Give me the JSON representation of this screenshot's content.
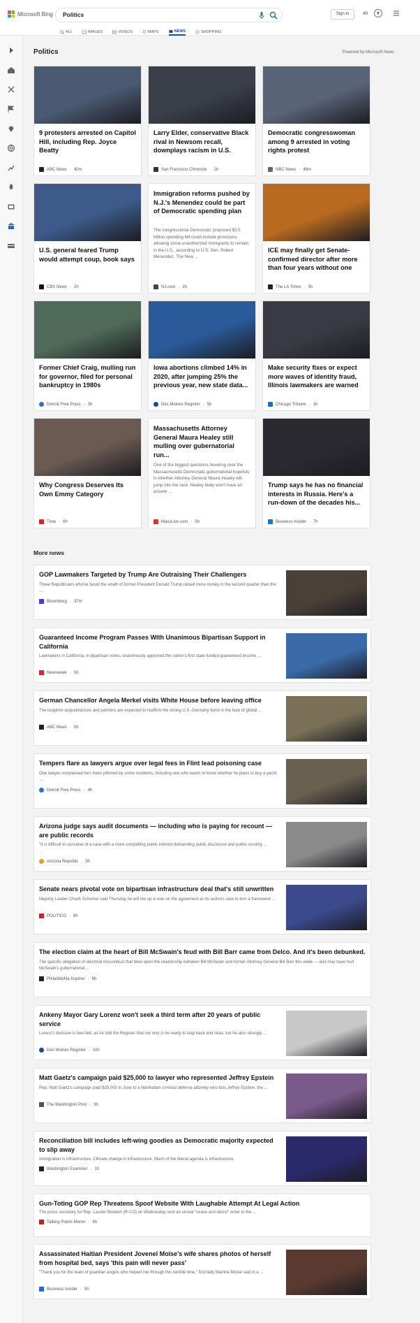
{
  "header": {
    "logo_text": "Microsoft Bing",
    "query": "Politics",
    "sign_in": "Sign in",
    "points": "40",
    "tabs": [
      {
        "label": "ALL",
        "icon": "search-icon"
      },
      {
        "label": "IMAGES",
        "icon": "image-icon"
      },
      {
        "label": "VIDEOS",
        "icon": "video-icon"
      },
      {
        "label": "MAPS",
        "icon": "map-pin-icon"
      },
      {
        "label": "NEWS",
        "icon": "news-icon",
        "active": true
      },
      {
        "label": "SHOPPING",
        "icon": "tag-icon"
      }
    ]
  },
  "rail_icons": [
    "chevron-right-icon",
    "home-icon",
    "topics-icon",
    "flag-icon",
    "location-icon",
    "globe-icon",
    "chart-icon",
    "rocket-icon",
    "film-icon",
    "politics-icon",
    "card-icon"
  ],
  "section": {
    "title": "Politics",
    "powered": "Powered by Microsoft News"
  },
  "cards": [
    {
      "title": "9 protesters arrested on Capitol Hill, including Rep. Joyce Beatty",
      "source": "ABC News",
      "time": "40m",
      "color": "#4a5a72"
    },
    {
      "title": "Larry Elder, conservative Black rival in Newsom recall, downplays racism in U.S.",
      "source": "San Francisco Chronicle",
      "time": "1h",
      "color": "#3a3f4a"
    },
    {
      "title": "Democratic congresswoman among 9 arrested in voting rights protest",
      "source": "NBC News",
      "time": "46m",
      "color": "#5a6478"
    },
    {
      "title": "U.S. general feared Trump would attempt coup, book says",
      "source": "CBS News",
      "time": "2h",
      "color": "#3d5a8a"
    },
    {
      "title": "Immigration reforms pushed by N.J.'s Menendez could be part of Democratic spending plan",
      "snippet": "The congressional Democrats' proposed $3.5 trillion spending bill could include provisions allowing some unauthorized immigrants to remain in the U.S., according to U.S. Sen. Robert Menendez. The New ...",
      "source": "NJ.com",
      "time": "2h"
    },
    {
      "title": "ICE may finally get Senate-confirmed director after more than four years without one",
      "source": "The LA Times",
      "time": "5h",
      "color": "#b86a20"
    },
    {
      "title": "Former Chief Craig, mulling run for governor, filed for personal bankruptcy in 1980s",
      "source": "Detroit Free Press",
      "time": "2h",
      "color": "#4f6a58"
    },
    {
      "title": "Iowa abortions climbed 14% in 2020, after jumping 25% the previous year, new state data...",
      "source": "Des Moines Register",
      "time": "5h",
      "color": "#2b5a9a"
    },
    {
      "title": "Make security fixes or expect more waves of identity fraud, Illinois lawmakers are warned",
      "source": "Chicago Tribune",
      "time": "1h",
      "color": "#3a3a44"
    },
    {
      "title": "Why Congress Deserves Its Own Emmy Category",
      "source": "Time",
      "time": "6h",
      "color": "#6a5a52"
    },
    {
      "title": "Massachusetts Attorney General Maura Healey still mulling over gubernatorial run...",
      "snippet": "One of the biggest questions hovering over the Massachusetts Democratic gubernatorial hopefuls is whether Attorney General Maura Healey will jump into the race. Healey likely won't have an answer ...",
      "source": "MassLive.com",
      "time": "5h"
    },
    {
      "title": "Trump says he has no financial interests in Russia. Here's a run-down of the decades his...",
      "source": "Business Insider",
      "time": "7h",
      "color": "#2a2a30"
    }
  ],
  "more_news_title": "More news",
  "more_news": [
    {
      "title": "GOP Lawmakers Targeted by Trump Are Outraising Their Challengers",
      "snippet": "Three Republicans who've faced the wrath of former President Donald Trump raised more money in the second quarter than the ...",
      "source": "Bloomberg",
      "time": "37m",
      "color": "#4a4038"
    },
    {
      "title": "Guaranteed Income Program Passes With Unanimous Bipartisan Support in California",
      "snippet": "Lawmakers in California, in bipartisan votes, unanimously approved the nation's first state-funded guaranteed income ...",
      "source": "Newsweek",
      "time": "5h",
      "color": "#3a6aa8"
    },
    {
      "title": "German Chancellor Angela Merkel visits White House before leaving office",
      "snippet": "The longtime acquaintances and partners are expected to reaffirm the strong U.S.-Germany bond in the face of global ...",
      "source": "ABC News",
      "time": "5h",
      "color": "#7a7058"
    },
    {
      "title": "Tempers flare as lawyers argue over legal fees in Flint lead poisoning case",
      "snippet": "One lawyer complained he's been pilloried by some residents, including one who wants to know whether he plans to buy a yacht ...",
      "source": "Detroit Free Press",
      "time": "4h",
      "color": "#6a6050"
    },
    {
      "title": "Arizona judge says audit documents — including who is paying for recount — are public records",
      "snippet": "\"It is difficult to conceive of a case with a more compelling public interest demanding public disclosure and public scrutiny ...",
      "source": "Arizona Republic",
      "time": "5h",
      "color": "#8a8a8a"
    },
    {
      "title": "Senate nears pivotal vote on bipartisan infrastructure deal that's still unwritten",
      "snippet": "Majority Leader Chuck Schumer said Thursday he will tee up a vote on the agreement as its authors race to turn a framework ...",
      "source": "POLITICO",
      "time": "8h",
      "color": "#3a4a8a"
    },
    {
      "title": "The election claim at the heart of Bill McSwain's feud with Bill Barr came from Delco. And it's been debunked.",
      "snippet": "The specific allegation of electoral misconduct that blew open the relationship between Bill McSwain and former Attorney General Bill Barr this week — and may have hurt McSwain's gubernatorial ...",
      "source": "Philadelphia Inquirer",
      "time": "6h"
    },
    {
      "title": "Ankeny Mayor Gary Lorenz won't seek a third term after 20 years of public service",
      "snippet": "Lorenz's decision is two-fold, as he told the Register that not only is he ready to step back and relax, but he also strongly ...",
      "source": "Des Moines Register",
      "time": "10h",
      "color": "#c8c8c8"
    },
    {
      "title": "Matt Gaetz's campaign paid $25,000 to lawyer who represented Jeffrey Epstein",
      "snippet": "Rep. Matt Gaetz's campaign paid $25,000 in June to a Manhattan criminal defense attorney who lists Jeffrey Epstein, the ...",
      "source": "The Washington Post",
      "time": "3h",
      "color": "#7a5a8a"
    },
    {
      "title": "Reconciliation bill includes left-wing goodies as Democratic majority expected to slip away",
      "snippet": "Immigration is infrastructure. Climate change is infrastructure. Much of the liberal agenda is infrastructure.",
      "source": "Washington Examiner",
      "time": "1h",
      "color": "#2a2a6a"
    },
    {
      "title": "Gun-Toting GOP Rep Threatens Spoof Website With Laughable Attempt At Legal Action",
      "snippet": "The press secretary for Rep. Lauren Boebert (R-CO) on Wednesday sent an unreal \"cease and desist\" order to the ...",
      "source": "Talking Points Memo",
      "time": "4h"
    },
    {
      "title": "Assassinated Haitian President Jovenel Moïse's wife shares photos of herself from hospital bed, says 'this pain will never pass'",
      "snippet": "\"Thank you for the team of guardian angels who helped me through this terrible time,\" first lady Martine Moïse said in a ...",
      "source": "Business Insider",
      "time": "5h",
      "color": "#5a3a30"
    }
  ]
}
